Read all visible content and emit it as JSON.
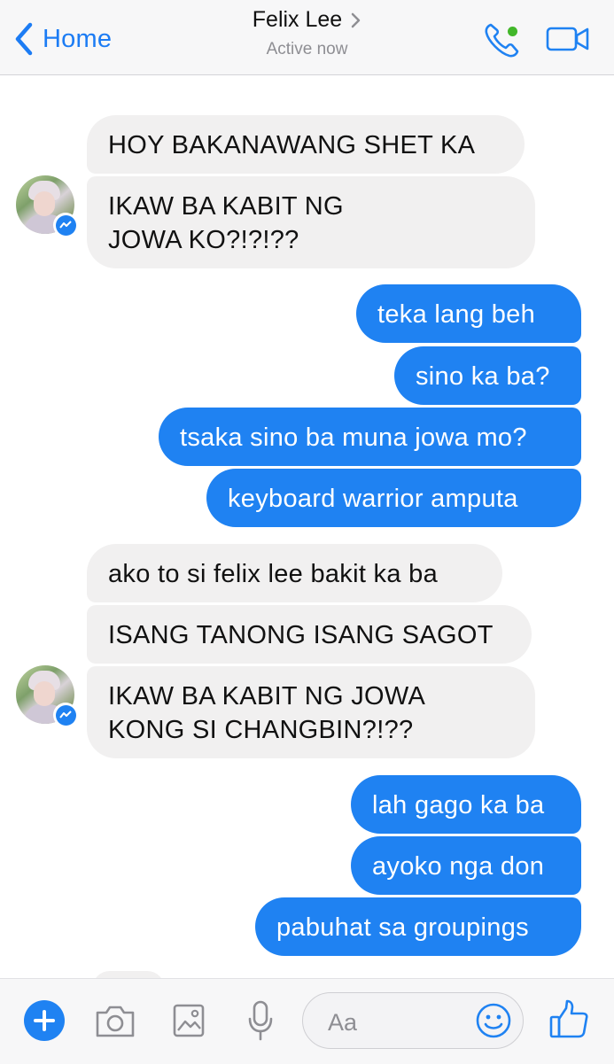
{
  "header": {
    "back_label": "Home",
    "contact_name": "Felix Lee",
    "status": "Active now",
    "icons": [
      "chevron-left-icon",
      "chevron-right-icon",
      "phone-icon",
      "video-camera-icon"
    ],
    "accent_color": "#1c7cf4",
    "online_color": "#42b72a"
  },
  "messages": [
    {
      "from": "contact",
      "text": "HOY BAKANAWANG SHET KA"
    },
    {
      "from": "contact",
      "text": "IKAW BA KABIT NG\nJOWA KO?!?!??"
    },
    {
      "from": "me",
      "text": "teka lang beh"
    },
    {
      "from": "me",
      "text": "sino ka ba?"
    },
    {
      "from": "me",
      "text": "tsaka sino ba muna jowa mo?"
    },
    {
      "from": "me",
      "text": "keyboard warrior amputa"
    },
    {
      "from": "contact",
      "text": "ako to si felix lee bakit ka ba"
    },
    {
      "from": "contact",
      "text": "ISANG TANONG ISANG SAGOT"
    },
    {
      "from": "contact",
      "text": "IKAW BA KABIT NG JOWA\nKONG SI CHANGBIN?!??"
    },
    {
      "from": "me",
      "text": "lah gago ka ba"
    },
    {
      "from": "me",
      "text": "ayoko nga don"
    },
    {
      "from": "me",
      "text": "pabuhat sa groupings"
    }
  ],
  "colors": {
    "outgoing_bubble": "#1f82f2",
    "incoming_bubble": "#f1f0f0"
  },
  "composer": {
    "placeholder": "Aa",
    "icons": [
      "plus-icon",
      "camera-icon",
      "image-icon",
      "microphone-icon",
      "emoji-icon",
      "thumbs-up-icon"
    ]
  }
}
